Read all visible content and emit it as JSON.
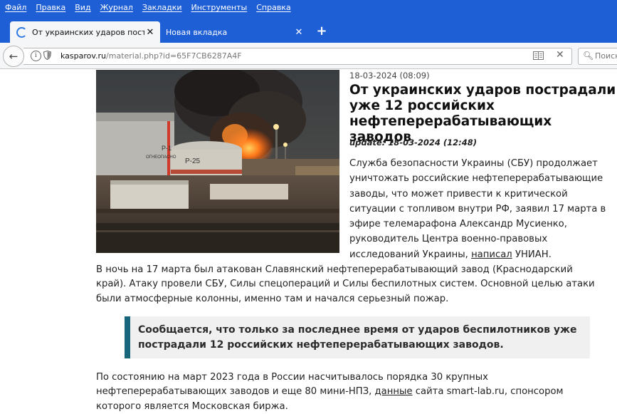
{
  "menu": [
    "Файл",
    "Правка",
    "Вид",
    "Журнал",
    "Закладки",
    "Инструменты",
    "Справка"
  ],
  "tabs": [
    {
      "label": "От украинских ударов пост...",
      "active": true
    },
    {
      "label": "Новая вкладка",
      "active": false
    }
  ],
  "newtab_symbol": "+",
  "close_symbol": "✕",
  "url": {
    "domain": "kasparov.ru",
    "path": "/material.php?id=65F7CB6287A4F"
  },
  "search": {
    "placeholder": "Поиск"
  },
  "article": {
    "date": "18-03-2024 (08:09)",
    "title": "От украинских ударов пострадали уже 12 российских нефтеперерабатывающих заводов",
    "update": "update: 18-03-2024 (12:48)",
    "lead_text": "Служба безопасности Украины (СБУ) продолжает уничтожать российские нефтеперерабатывающие заводы, что может привести к критической ситуации с топливом внутри РФ, заявил 17 марта в эфире телемарафона Александр Мусиенко, руководитель Центра военно-правовых исследований Украины,",
    "lead_link": "написал",
    "lead_tail": "УНИАН.",
    "paragraph1": "В ночь на 17 марта был атакован Славянский нефтеперерабатывающий завод (Краснодарский край). Атаку провели СБУ, Силы спецопераций и Силы беспилотных систем. Основной целью атаки были атмосферные колонны, именно там и начался серьезный пожар.",
    "quote": "Сообщается, что только за последнее время от ударов беспилотников уже пострадали 12 российских нефтеперерабатывающих заводов.",
    "paragraph2_start": "По состоянию на март 2023 года в России насчитывалось порядка 30 крупных нефтеперерабатывающих заводов и еще 80 мини-НПЗ,",
    "paragraph2_link": "данные",
    "paragraph2_end": "сайта smart-lab.ru, спонсором которого является Московская биржа.",
    "photo_tank_labels": [
      "P-1",
      "ОГНЕОПАСНО",
      "P-25"
    ]
  },
  "colors": {
    "menubar": "#1f5fd6",
    "quote_border": "#17657a"
  }
}
